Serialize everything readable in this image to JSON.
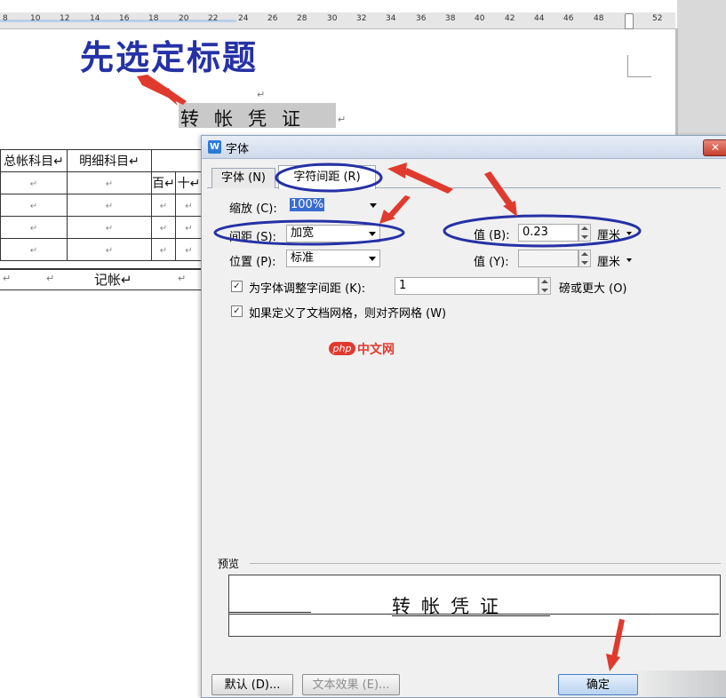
{
  "ruler": {
    "ticks": [
      "8",
      "10",
      "12",
      "14",
      "16",
      "18",
      "20",
      "22",
      "24",
      "26",
      "28",
      "30",
      "32",
      "34",
      "36",
      "38",
      "40",
      "42",
      "44",
      "46",
      "48",
      "52"
    ]
  },
  "annotation": {
    "headline": "先选定标题",
    "watermark_logo": "php",
    "watermark_text": "中文网"
  },
  "document": {
    "title": "转帐凭证",
    "para_mark": "↵",
    "table": {
      "header": [
        "总帐科目↵",
        "明细科目↵",
        ""
      ],
      "subheader": [
        "百↵",
        "十↵"
      ],
      "cell_mark": "↵",
      "signature_label": "记帐↵"
    }
  },
  "dialog": {
    "app_icon": "W",
    "title": "字体",
    "close_glyph": "✕",
    "tabs": [
      {
        "label": "字体 (N)"
      },
      {
        "label": "字符间距 (R)"
      }
    ],
    "scale": {
      "label": "缩放 (C):",
      "value": "100%"
    },
    "spacing": {
      "label": "间距 (S):",
      "value": "加宽"
    },
    "position": {
      "label": "位置 (P):",
      "value": "标准"
    },
    "spacing_by": {
      "label": "值 (B):",
      "value": "0.23",
      "unit": "厘米"
    },
    "position_by": {
      "label": "值 (Y):",
      "value": "",
      "unit": "厘米"
    },
    "kerning": {
      "checked": true,
      "label": "为字体调整字间距 (K):",
      "value": "1",
      "suffix": "磅或更大 (O)"
    },
    "snap_grid": {
      "checked": true,
      "label": "如果定义了文档网格，则对齐网格 (W)"
    },
    "preview": {
      "label": "预览",
      "text": "转帐凭证"
    },
    "buttons": {
      "default": "默认 (D)...",
      "text_effect": "文本效果 (E)...",
      "ok": "确定"
    }
  },
  "colors": {
    "annotation_red": "#e03a2e",
    "annotation_blue": "#2531a6",
    "selection": "#3b6ccf"
  }
}
